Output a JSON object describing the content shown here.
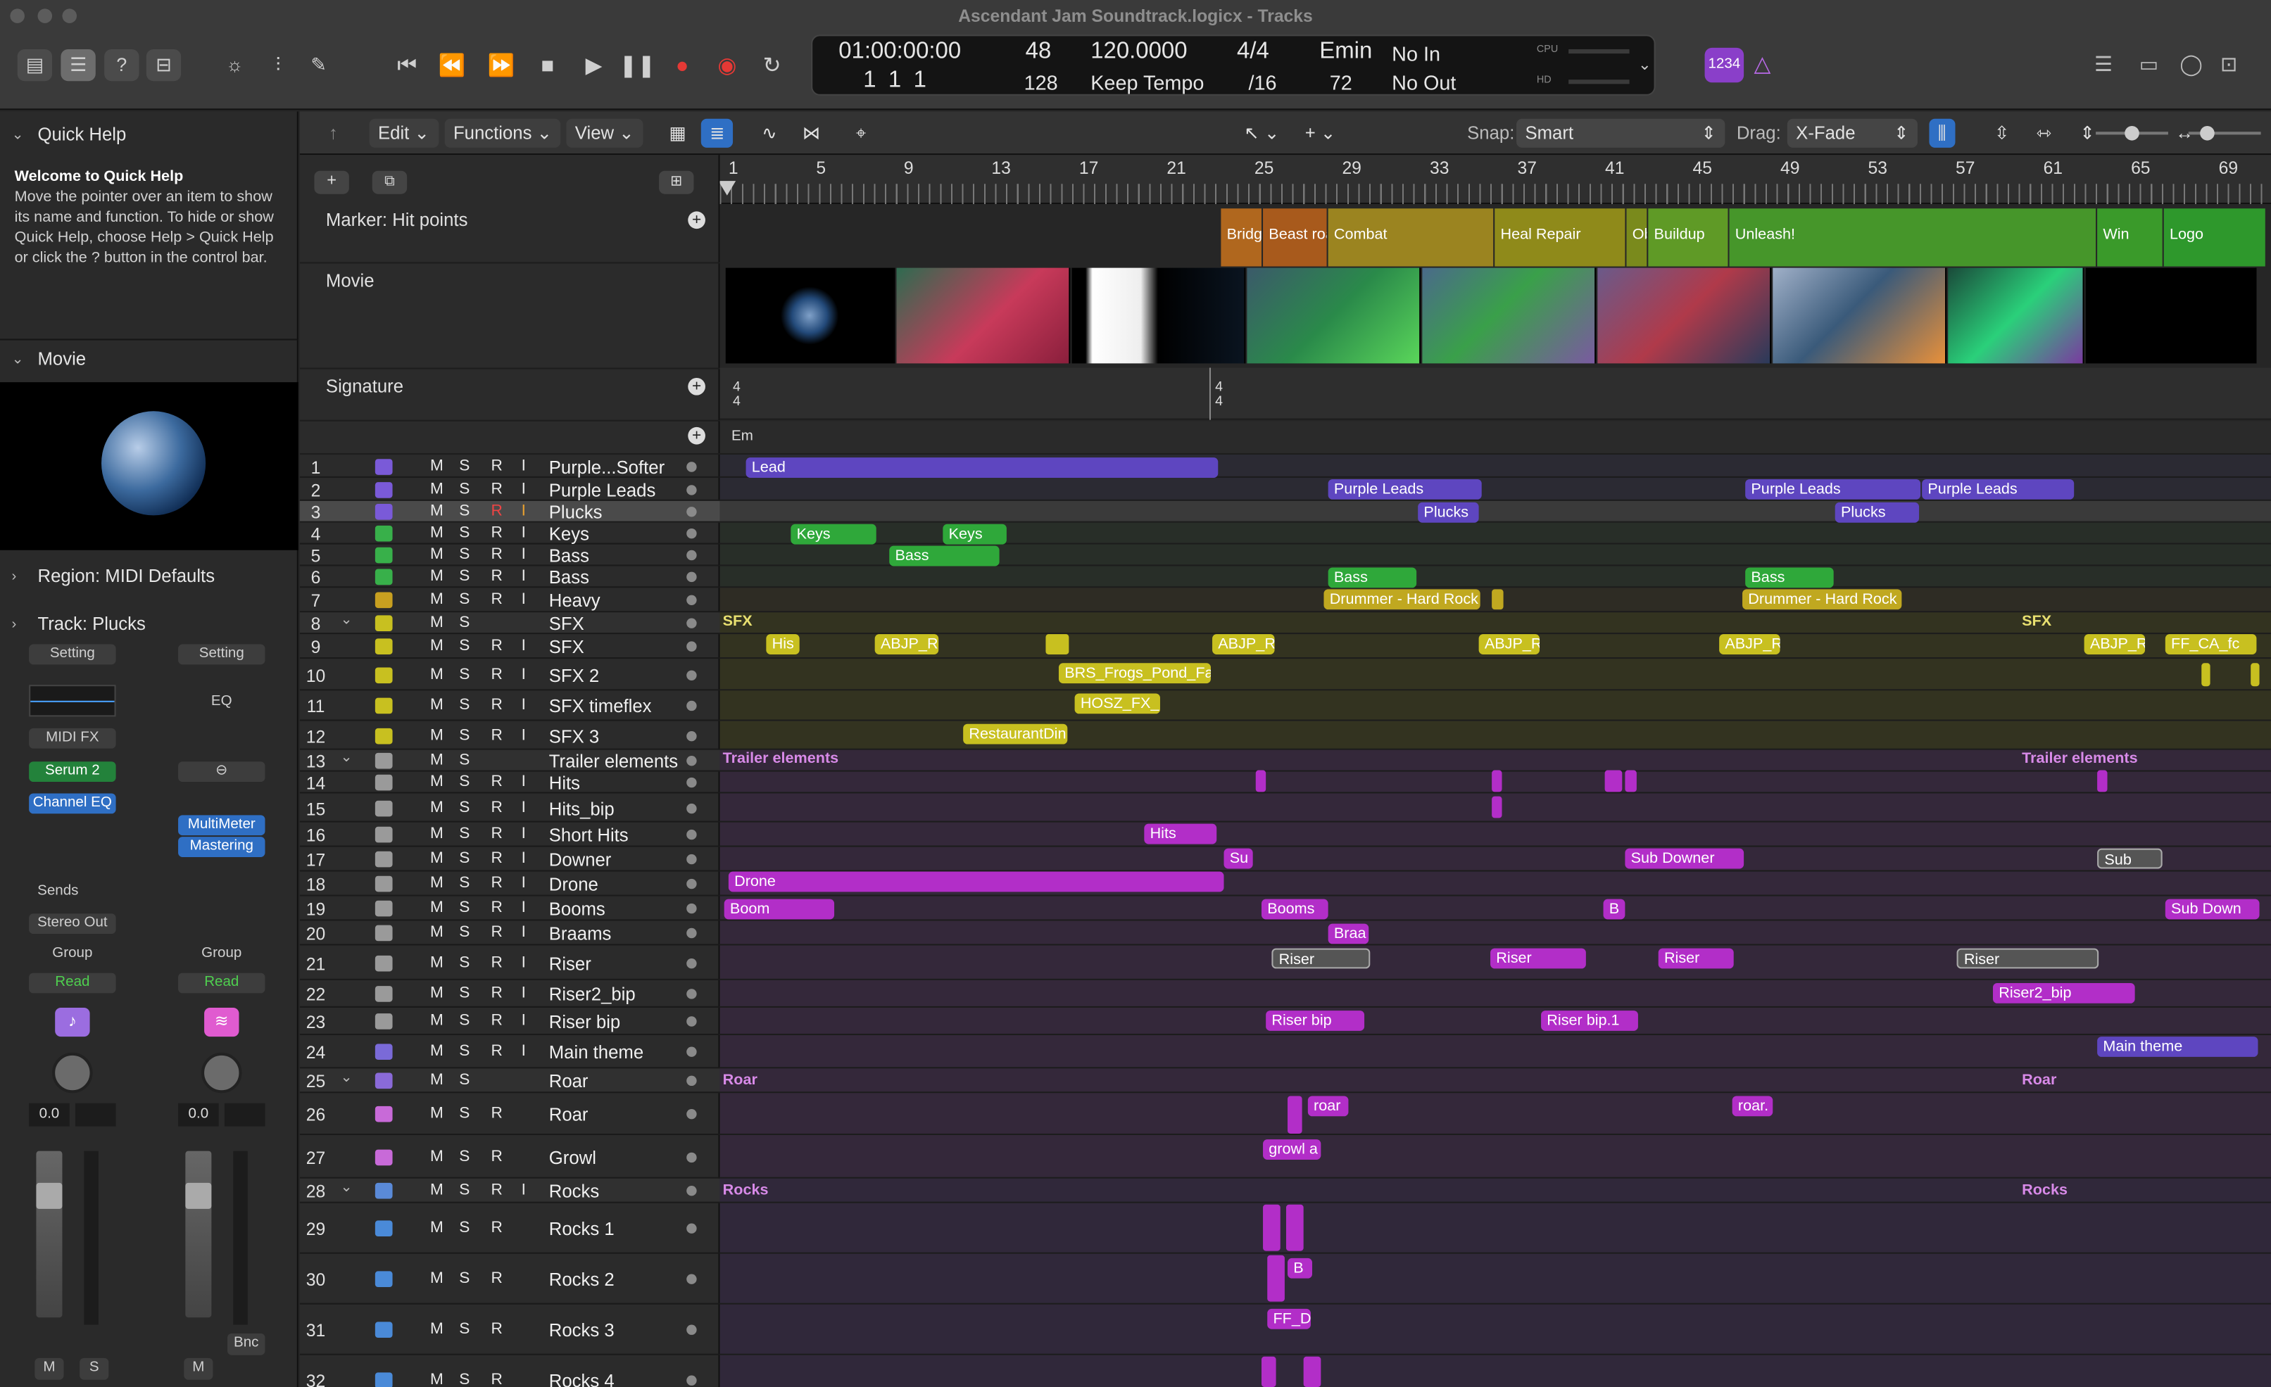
{
  "title": "Ascendant Jam Soundtrack.logicx - Tracks",
  "lcd": {
    "time": "01:00:00:00",
    "position": "1  1  1",
    "bar": "48",
    "beat": "128",
    "tempo": "120.0000",
    "tempo_mode": "Keep Tempo",
    "signature": "4/4",
    "division": "/16",
    "key": "Emin",
    "key_value": "72",
    "in": "No In",
    "out": "No Out",
    "cpu": "CPU",
    "hd": "HD"
  },
  "count_in": "1234",
  "menus": {
    "edit": "Edit",
    "functions": "Functions",
    "view": "View",
    "snap_label": "Snap:",
    "snap": "Smart",
    "drag_label": "Drag:",
    "drag": "X-Fade"
  },
  "quick_help": {
    "header": "Quick Help",
    "title": "Welcome to Quick Help",
    "body": "Move the pointer over an item to show its name and function. To hide or show Quick Help, choose Help > Quick Help or click the ? button in the control bar."
  },
  "inspector": {
    "movie": "Movie",
    "region": "Region: MIDI Defaults",
    "track": "Track: Plucks"
  },
  "strip": {
    "setting": "Setting",
    "midi_fx": "MIDI FX",
    "serum": "Serum 2",
    "channel_eq": "Channel EQ",
    "sends": "Sends",
    "stereo_out": "Stereo Out",
    "group": "Group",
    "read": "Read",
    "vol": "0.0",
    "m": "M",
    "s": "S",
    "eq": "EQ",
    "multimeter": "MultiMeter",
    "mastering": "Mastering",
    "bnc": "Bnc"
  },
  "global_tracks": {
    "marker": "Marker: Hit points",
    "movie": "Movie",
    "signature": "Signature",
    "chord": "Em"
  },
  "ruler": [
    "1",
    "5",
    "9",
    "13",
    "17",
    "21",
    "25",
    "29",
    "33",
    "37",
    "41",
    "45",
    "49",
    "53",
    "57",
    "61",
    "65",
    "69"
  ],
  "markers": [
    "Bridg jump",
    "Beast roa",
    "Combat",
    "Heal Repair",
    "Ob Fa",
    "Buildup",
    "Unleash!",
    "Win",
    "Logo"
  ],
  "signature_values": [
    "4",
    "4",
    "4",
    "4"
  ],
  "tracks": [
    {
      "n": "1",
      "name": "Purple...Softer"
    },
    {
      "n": "2",
      "name": "Purple Leads"
    },
    {
      "n": "3",
      "name": "Plucks"
    },
    {
      "n": "4",
      "name": "Keys"
    },
    {
      "n": "5",
      "name": "Bass"
    },
    {
      "n": "6",
      "name": "Bass"
    },
    {
      "n": "7",
      "name": "Heavy"
    },
    {
      "n": "8",
      "name": "SFX"
    },
    {
      "n": "9",
      "name": "SFX"
    },
    {
      "n": "10",
      "name": "SFX 2"
    },
    {
      "n": "11",
      "name": "SFX  timeflex"
    },
    {
      "n": "12",
      "name": "SFX 3"
    },
    {
      "n": "13",
      "name": "Trailer elements"
    },
    {
      "n": "14",
      "name": "Hits"
    },
    {
      "n": "15",
      "name": "Hits_bip"
    },
    {
      "n": "16",
      "name": "Short Hits"
    },
    {
      "n": "17",
      "name": "Downer"
    },
    {
      "n": "18",
      "name": "Drone"
    },
    {
      "n": "19",
      "name": "Booms"
    },
    {
      "n": "20",
      "name": "Braams"
    },
    {
      "n": "21",
      "name": "Riser"
    },
    {
      "n": "22",
      "name": "Riser2_bip"
    },
    {
      "n": "23",
      "name": "Riser bip"
    },
    {
      "n": "24",
      "name": "Main theme"
    },
    {
      "n": "25",
      "name": "Roar"
    },
    {
      "n": "26",
      "name": "Roar"
    },
    {
      "n": "27",
      "name": "Growl"
    },
    {
      "n": "28",
      "name": "Rocks"
    },
    {
      "n": "29",
      "name": "Rocks 1"
    },
    {
      "n": "30",
      "name": "Rocks 2"
    },
    {
      "n": "31",
      "name": "Rocks 3"
    },
    {
      "n": "32",
      "name": "Rocks 4"
    }
  ],
  "msri": {
    "m": "M",
    "s": "S",
    "r": "R",
    "i": "I"
  },
  "regions": [
    "Lead",
    "Purple Leads",
    "Plucks",
    "Purple Leads",
    "Plucks",
    "Purple Leads",
    "Keys",
    "Keys",
    "Bass",
    "Bass",
    "Bass",
    "Drummer - Hard Rock",
    "Drummer - Hard Rock",
    "SFX",
    "His",
    "ABJP_R",
    "ABJP_R",
    "ABJP_R",
    "ABJP_R",
    "ABJP_R",
    "FF_CA_fc",
    "BRS_Frogs_Pond_Far",
    "HOSZ_FX_",
    "RestaurantDin",
    "Trailer elements",
    "Hits",
    "Su",
    "Sub Downer",
    "Sub",
    "Drone",
    "Boom",
    "Booms",
    "B",
    "Sub Down",
    "Braa",
    "Riser",
    "Riser",
    "Riser",
    "Riser",
    "Riser2_bip",
    "Riser bip",
    "Riser bip.1",
    "Main theme",
    "Roar",
    "roar",
    "roar.",
    "growl a",
    "Rocks",
    "B",
    "FF_D"
  ]
}
